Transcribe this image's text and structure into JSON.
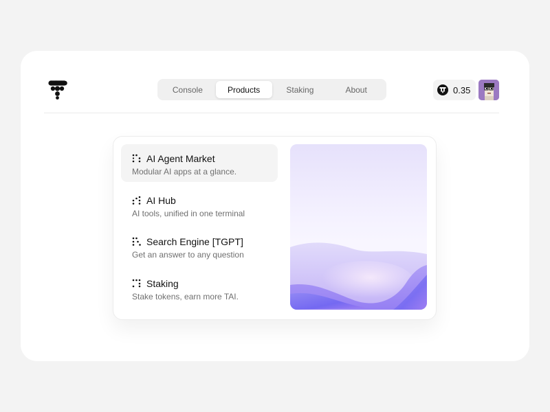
{
  "header": {
    "logo_icon": "tai-logo-icon",
    "nav": {
      "tabs": [
        {
          "label": "Console",
          "active": false
        },
        {
          "label": "Products",
          "active": true
        },
        {
          "label": "Staking",
          "active": false
        },
        {
          "label": "About",
          "active": false
        }
      ]
    },
    "balance": {
      "icon": "token-icon",
      "value": "0.35"
    },
    "avatar_icon": "avatar"
  },
  "products_menu": {
    "items": [
      {
        "icon": "dots-icon",
        "title": "AI Agent Market",
        "description": "Modular AI apps at a glance.",
        "active": true
      },
      {
        "icon": "dots-icon",
        "title": "AI Hub",
        "description": "AI tools, unified in one terminal",
        "active": false
      },
      {
        "icon": "dots-icon",
        "title": "Search Engine [TGPT]",
        "description": "Get an answer to any question",
        "active": false
      },
      {
        "icon": "dots-icon",
        "title": "Staking",
        "description": "Stake tokens, earn more TAI.",
        "active": false
      }
    ],
    "preview_colors": [
      "#e7e3fb",
      "#f7f4ff",
      "#c7b5f7",
      "#7268f2"
    ]
  }
}
